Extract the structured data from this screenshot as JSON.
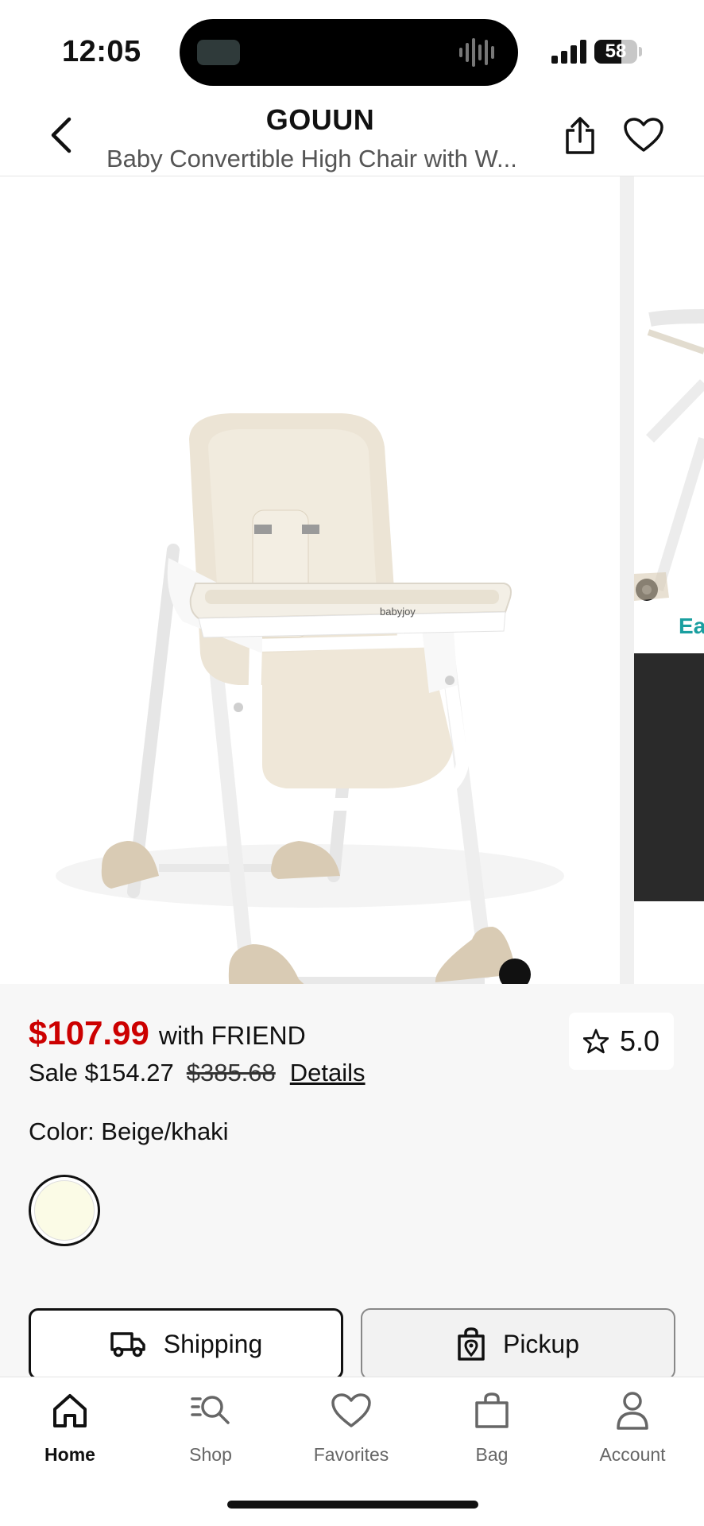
{
  "status_bar": {
    "time": "12:05",
    "battery": "58"
  },
  "header": {
    "brand": "GOUUN",
    "subtitle": "Baby Convertible High Chair with W..."
  },
  "carousel": {
    "product_logo_text": "babyjoy",
    "next_slide_text": "Eas"
  },
  "pricing": {
    "price": "$107.99",
    "price_suffix": "with FRIEND",
    "sale_price": "Sale $154.27",
    "original_price": "$385.68",
    "details_link": "Details",
    "rating": "5.0"
  },
  "color": {
    "label": "Color: Beige/khaki",
    "swatch_color": "#fbfbe6"
  },
  "fulfillment": {
    "shipping_label": "Shipping",
    "pickup_label": "Pickup"
  },
  "tabs": [
    {
      "label": "Home",
      "icon": "home-icon"
    },
    {
      "label": "Shop",
      "icon": "shop-search-icon"
    },
    {
      "label": "Favorites",
      "icon": "heart-icon"
    },
    {
      "label": "Bag",
      "icon": "bag-icon"
    },
    {
      "label": "Account",
      "icon": "person-icon"
    }
  ],
  "colors": {
    "price_red": "#cc0000",
    "teal_text": "#1a9fa0"
  }
}
